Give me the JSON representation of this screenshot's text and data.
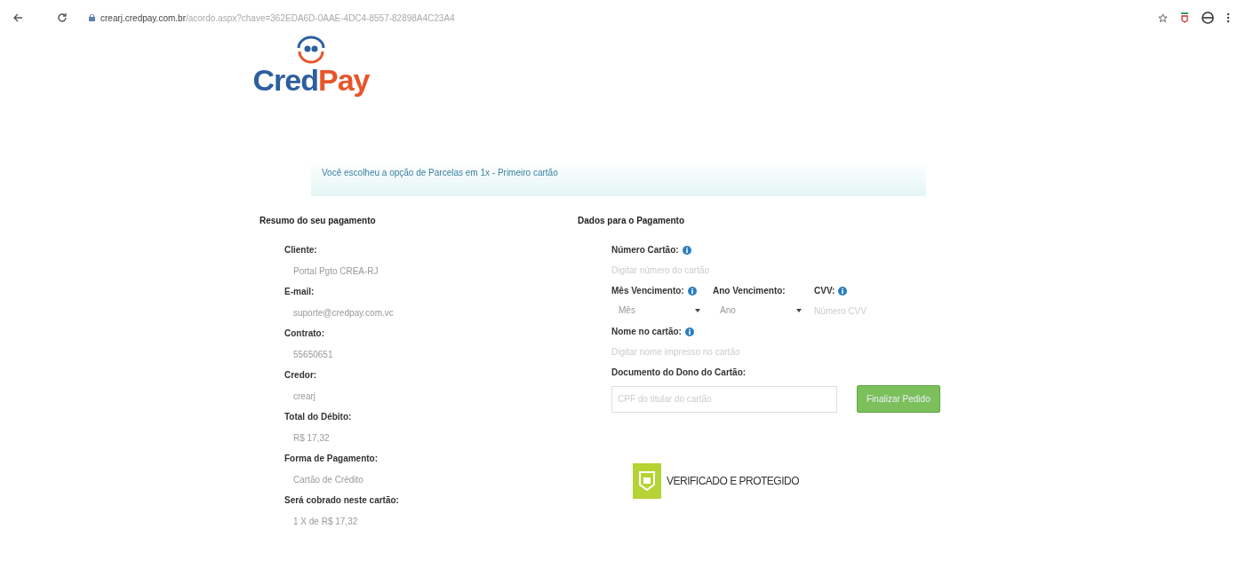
{
  "browser": {
    "url_host": "crearj.credpay.com.br",
    "url_path": "/acordo.aspx?chave=362EDA6D-0AAE-4DC4-8557-82898A4C23A4"
  },
  "logo": {
    "part1": "Cred",
    "part2": "Pay"
  },
  "alert": "Você escolheu a opção de Parcelas em 1x - Primeiro cartão",
  "summary": {
    "title": "Resumo do seu pagamento",
    "items": [
      {
        "label": "Cliente:",
        "value": "Portal Pgto CREA-RJ"
      },
      {
        "label": "E-mail:",
        "value": "suporte@credpay.com.vc"
      },
      {
        "label": "Contrato:",
        "value": "55650651"
      },
      {
        "label": "Credor:",
        "value": "crearj"
      },
      {
        "label": "Total do Débito:",
        "value": "R$ 17,32"
      },
      {
        "label": "Forma de Pagamento:",
        "value": "Cartão de Crédito"
      },
      {
        "label": "Será cobrado neste cartão:",
        "value": "1 X de R$ 17,32"
      }
    ]
  },
  "payment": {
    "title": "Dados para o Pagamento",
    "card_number": {
      "label": "Número Cartão:",
      "placeholder": "Digitar número do cartão"
    },
    "month": {
      "label": "Mês Vencimento:",
      "value": "Mês"
    },
    "year": {
      "label": "Ano Vencimento:",
      "value": "Ano"
    },
    "cvv": {
      "label": "CVV:",
      "placeholder": "Número CVV"
    },
    "name": {
      "label": "Nome no cartão:",
      "placeholder": "Digitar nome impresso no cartão"
    },
    "document": {
      "label": "Documento do Dono do Cartão:",
      "placeholder": "CPF do titular do cartão"
    },
    "submit": "Finalizar Pedido"
  },
  "badge": {
    "title": "VERIFICADO E PROTEGIDO"
  }
}
